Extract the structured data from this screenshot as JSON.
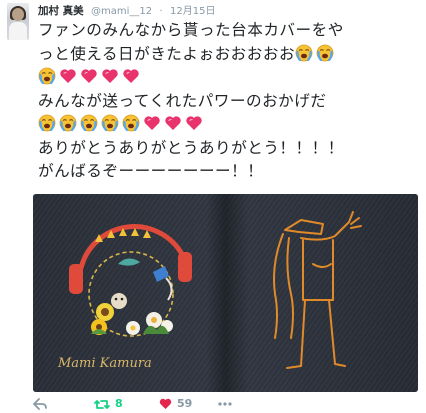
{
  "tweet": {
    "display_name": "加村 真美",
    "handle": "@mami__12",
    "separator": "·",
    "date": "12月15日",
    "lines": [
      {
        "text": "ファンのみんなから貰った台本カバーをや"
      },
      {
        "text": "っと使える日がきたよぉおおおおお",
        "emojis": [
          "cry",
          "cry"
        ]
      },
      {
        "text": "",
        "emojis": [
          "cry",
          "heart",
          "heart",
          "heart",
          "heart"
        ]
      },
      {
        "text": "みんなが送ってくれたパワーのおかげだ"
      },
      {
        "text": "",
        "emojis": [
          "cry",
          "cry",
          "cry",
          "cry",
          "cry",
          "heart",
          "heart",
          "heart"
        ]
      },
      {
        "text": "ありがとうありがとうありがとう！！！！"
      },
      {
        "text": "がんばるぞーーーーーーー！！"
      }
    ]
  },
  "media": {
    "embroidery_text": "Mami Kamura"
  },
  "actions": {
    "retweet_count": "8",
    "like_count": "59"
  },
  "colors": {
    "name": "#292f33",
    "meta": "#8899a6",
    "retweet": "#19cf86",
    "like": "#e2264d",
    "action_gray": "#8899a6",
    "denim": "#343a44",
    "thread_orange": "#e08a2a",
    "heart_pink": "#e8336d",
    "cry_yellow": "#f7c234"
  }
}
